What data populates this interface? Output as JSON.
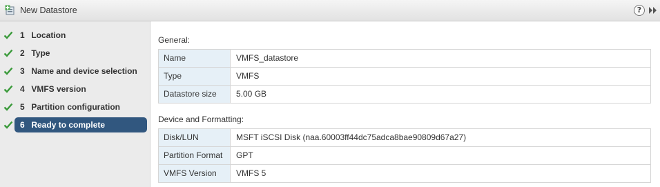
{
  "window": {
    "title": "New Datastore",
    "help_glyph": "?"
  },
  "steps": [
    {
      "number": "1",
      "label": "Location",
      "completed": true,
      "active": false
    },
    {
      "number": "2",
      "label": "Type",
      "completed": true,
      "active": false
    },
    {
      "number": "3",
      "label": "Name and device selection",
      "completed": true,
      "active": false
    },
    {
      "number": "4",
      "label": "VMFS version",
      "completed": true,
      "active": false
    },
    {
      "number": "5",
      "label": "Partition configuration",
      "completed": true,
      "active": false
    },
    {
      "number": "6",
      "label": "Ready to complete",
      "completed": true,
      "active": true
    }
  ],
  "general": {
    "heading": "General:",
    "rows": [
      {
        "key": "Name",
        "value": "VMFS_datastore"
      },
      {
        "key": "Type",
        "value": "VMFS"
      },
      {
        "key": "Datastore size",
        "value": "5.00 GB"
      }
    ]
  },
  "device": {
    "heading": "Device and Formatting:",
    "rows": [
      {
        "key": "Disk/LUN",
        "value": "MSFT iSCSI Disk (naa.60003ff44dc75adca8bae90809d67a27)"
      },
      {
        "key": "Partition Format",
        "value": "GPT"
      },
      {
        "key": "VMFS Version",
        "value": "VMFS 5"
      }
    ]
  },
  "colors": {
    "active_step_bg": "#31577f",
    "check_green": "#3a9a3a",
    "key_cell_bg": "#e6f0f7"
  }
}
